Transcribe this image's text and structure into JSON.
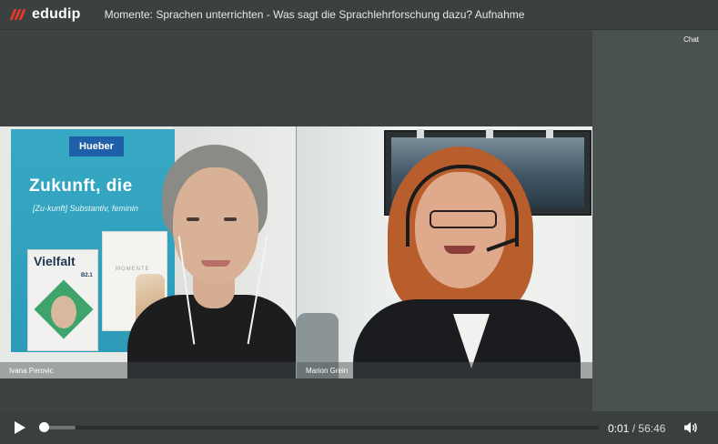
{
  "header": {
    "logo_text": "edudip",
    "title": "Momente: Sprachen unterrichten - Was sagt die Sprachlehrforschung dazu? Aufnahme"
  },
  "video": {
    "participants": [
      {
        "name": "Ivana Perovic"
      },
      {
        "name": "Marion Grein"
      }
    ],
    "banner": {
      "brand": "Hueber",
      "headline": "Zukunft, die",
      "subline": "[Zu·kunft] Substantiv, feminin",
      "book1_title": "Vielfalt",
      "book1_level": "B2.1",
      "book2_title": "MOMENTE"
    }
  },
  "sidebar": {
    "chat_label": "Chat"
  },
  "player": {
    "current_time": "0:01",
    "separator": "/",
    "duration": "56:46",
    "progress_fraction": 0.0003,
    "buffered_fraction": 0.06
  },
  "colors": {
    "logo_accent": "#e8362a",
    "background": "#3d4343",
    "chat_panel": "#4a5151"
  },
  "icons": {
    "play": "play-icon",
    "volume": "volume-icon",
    "logo": "edudip-logo-icon"
  }
}
